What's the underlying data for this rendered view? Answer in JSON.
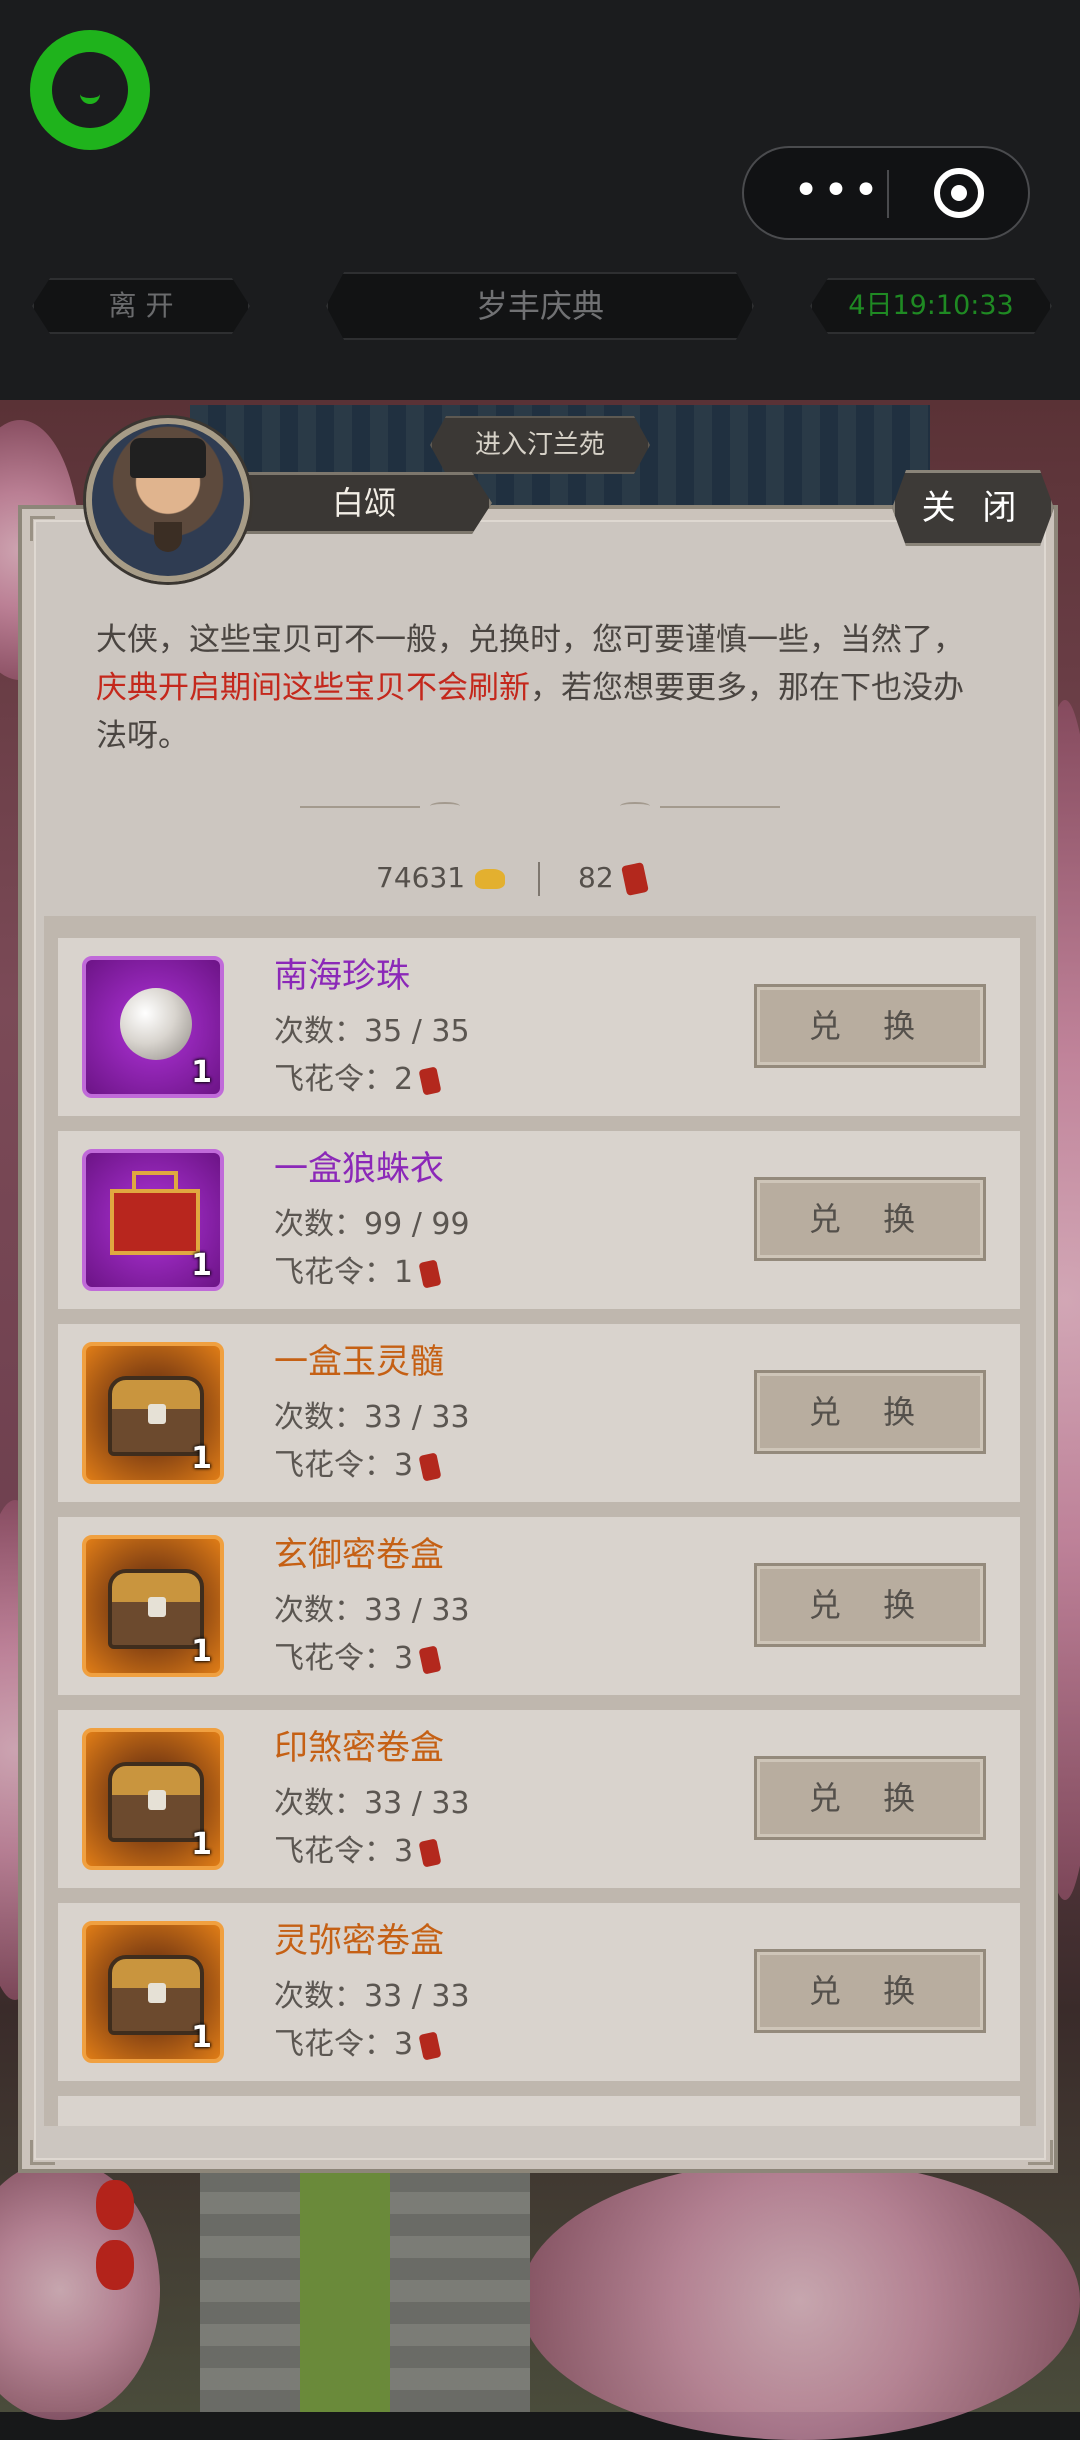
{
  "host_bar": {
    "more_label": "•••"
  },
  "nav": {
    "leave_label": "离 开",
    "title": "岁丰庆典",
    "countdown": "4日19:10:33"
  },
  "scene": {
    "enter_label": "进入汀兰苑"
  },
  "dialog": {
    "npc_name": "白颂",
    "close_label": "关 闭",
    "intro_part1": "大侠，这些宝贝可不一般，兑换时，您可要谨慎一些，当然了，",
    "intro_red": "庆典开启期间这些宝贝不会刷新",
    "intro_part2": "，若您想要更多，那在下也没办法呀。",
    "gold_amount": "74631",
    "token_amount": "82",
    "count_prefix": "次数：",
    "price_prefix": "飞花令：",
    "exchange_label": "兑 换"
  },
  "items": [
    {
      "name": "南海珍珠",
      "count": "35 / 35",
      "price": "2",
      "qty": "1",
      "rarity": "purple",
      "icon": "pearl-icon"
    },
    {
      "name": "一盒狼蛛衣",
      "count": "99 / 99",
      "price": "1",
      "qty": "1",
      "rarity": "purple",
      "icon": "gift-box-icon"
    },
    {
      "name": "一盒玉灵髓",
      "count": "33 / 33",
      "price": "3",
      "qty": "1",
      "rarity": "orange",
      "icon": "chest-icon"
    },
    {
      "name": "玄御密卷盒",
      "count": "33 / 33",
      "price": "3",
      "qty": "1",
      "rarity": "orange",
      "icon": "chest-icon"
    },
    {
      "name": "印煞密卷盒",
      "count": "33 / 33",
      "price": "3",
      "qty": "1",
      "rarity": "orange",
      "icon": "chest-icon"
    },
    {
      "name": "灵弥密卷盒",
      "count": "33 / 33",
      "price": "3",
      "qty": "1",
      "rarity": "orange",
      "icon": "chest-icon"
    }
  ],
  "colors": {
    "brand_green": "#1fb31c",
    "intro_red": "#c4281c",
    "purple_rarity": "#8b28b8",
    "orange_rarity": "#c56014"
  }
}
